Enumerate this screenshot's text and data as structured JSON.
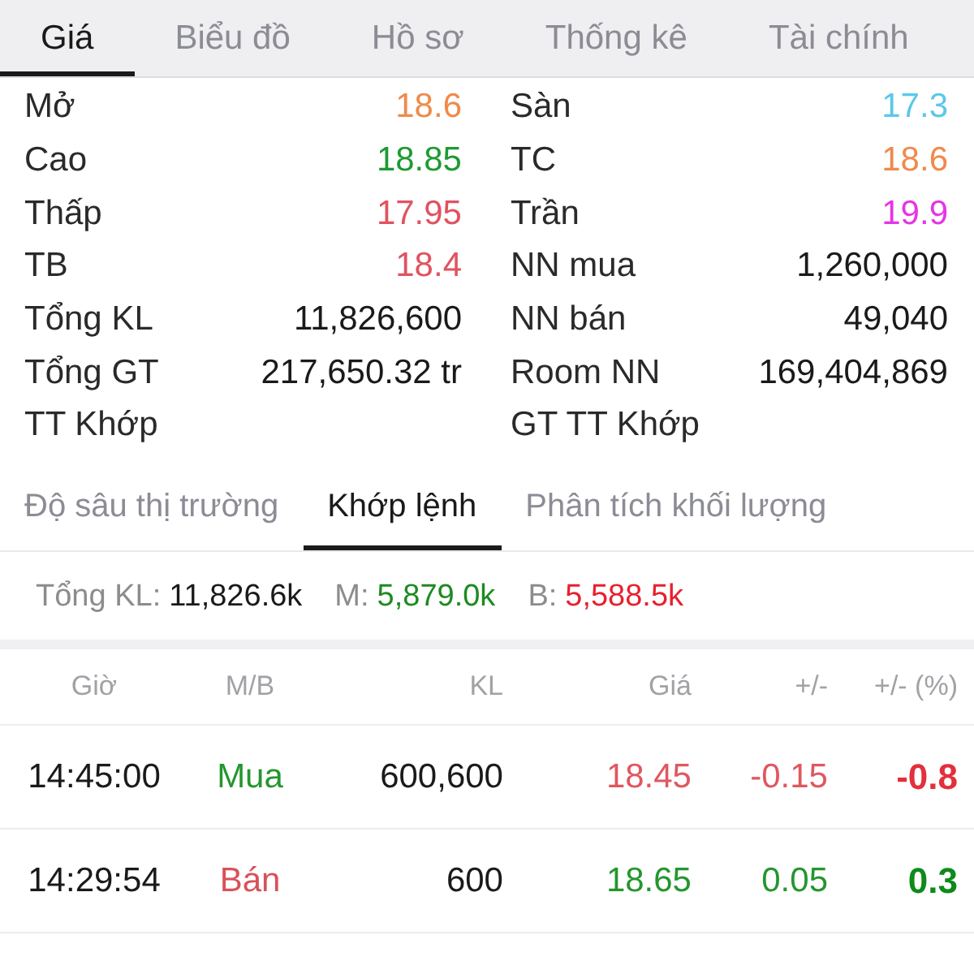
{
  "tabs": [
    {
      "label": "Giá",
      "selected": true
    },
    {
      "label": "Biểu đồ",
      "selected": false
    },
    {
      "label": "Hồ sơ",
      "selected": false
    },
    {
      "label": "Thống kê",
      "selected": false
    },
    {
      "label": "Tài chính",
      "selected": false
    }
  ],
  "quote": {
    "left": [
      {
        "label": "Mở",
        "value": "18.6",
        "color": "#f08a4b"
      },
      {
        "label": "Cao",
        "value": "18.85",
        "color": "#1e9a33"
      },
      {
        "label": "Thấp",
        "value": "17.95",
        "color": "#e0535f"
      },
      {
        "label": "TB",
        "value": "18.4",
        "color": "#e0535f"
      },
      {
        "label": "Tổng KL",
        "value": "11,826,600",
        "color": "#1a1a1a"
      },
      {
        "label": "Tổng GT",
        "value": "217,650.32 tr",
        "color": "#1a1a1a"
      },
      {
        "label": "TT Khớp"
      }
    ],
    "right": [
      {
        "label": "Sàn",
        "value": "17.3",
        "color": "#5bc8ea"
      },
      {
        "label": "TC",
        "value": "18.6",
        "color": "#f08a4b"
      },
      {
        "label": "Trần",
        "value": "19.9",
        "color": "#e535e5"
      },
      {
        "label": "NN mua",
        "value": "1,260,000",
        "color": "#1a1a1a"
      },
      {
        "label": "NN bán",
        "value": "49,040",
        "color": "#1a1a1a"
      },
      {
        "label": "Room NN",
        "value": "169,404,869",
        "color": "#1a1a1a"
      },
      {
        "label": "GT TT Khớp"
      }
    ]
  },
  "sub_tabs": [
    {
      "label": "Độ sâu thị trường",
      "selected": false
    },
    {
      "label": "Khớp lệnh",
      "selected": true
    },
    {
      "label": "Phân tích khối lượng",
      "selected": false
    }
  ],
  "summary": [
    {
      "label": "Tổng KL:",
      "value": "11,826.6k",
      "color": "#1a1a1a"
    },
    {
      "label": "M:",
      "value": "5,879.0k",
      "color": "#1e8a22"
    },
    {
      "label": "B:",
      "value": "5,588.5k",
      "color": "#e8202e"
    }
  ],
  "table": {
    "columns": [
      "Giờ",
      "M/B",
      "KL",
      "Giá",
      "+/-",
      "+/- (%)"
    ],
    "rows": [
      {
        "cells": [
          {
            "text": "14:45:00",
            "color": "#1a1a1a"
          },
          {
            "text": "Mua",
            "color": "#24962e"
          },
          {
            "text": "600,600",
            "color": "#1a1a1a"
          },
          {
            "text": "18.45",
            "color": "#e0575f"
          },
          {
            "text": "-0.15",
            "color": "#e0575f"
          },
          {
            "text": "-0.8",
            "color": "#e2303c"
          }
        ]
      },
      {
        "cells": [
          {
            "text": "14:29:54",
            "color": "#1a1a1a"
          },
          {
            "text": "Bán",
            "color": "#d9505a"
          },
          {
            "text": "600",
            "color": "#1a1a1a"
          },
          {
            "text": "18.65",
            "color": "#24962e"
          },
          {
            "text": "0.05",
            "color": "#24962e"
          },
          {
            "text": "0.3",
            "color": "#0e8a1c"
          }
        ]
      }
    ]
  }
}
